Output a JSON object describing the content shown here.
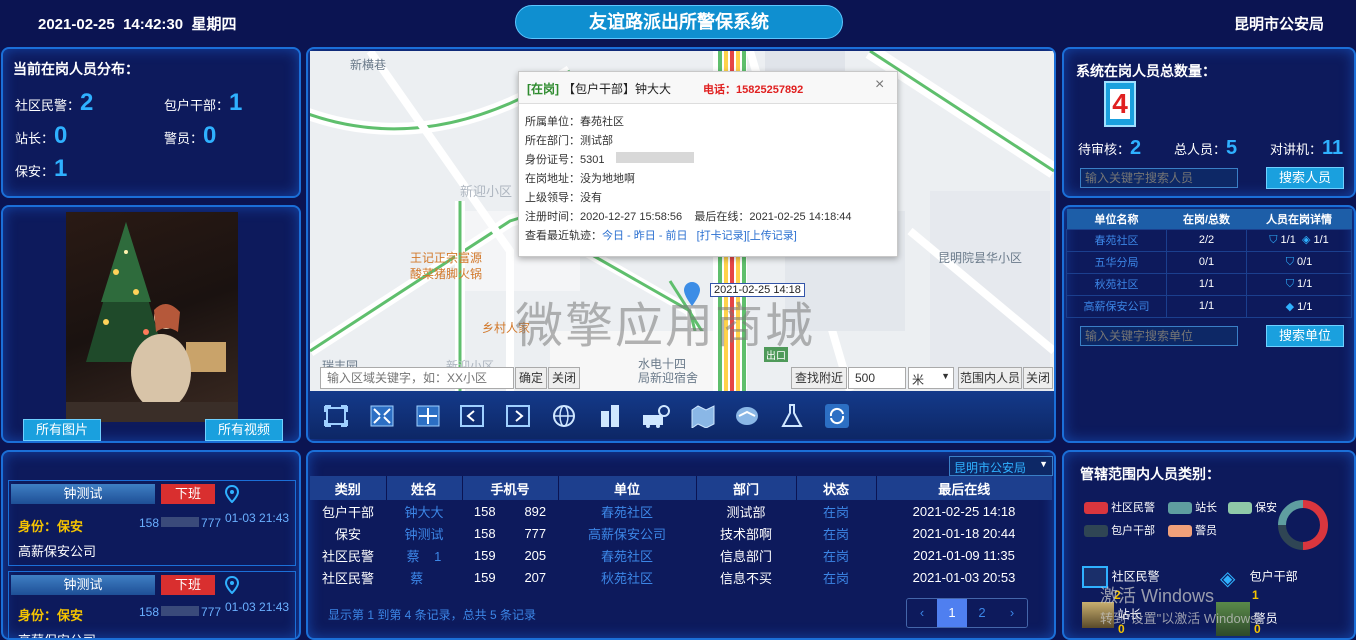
{
  "header": {
    "datetime": "2021-02-25  14:42:30  星期四",
    "title": "友谊路派出所警保系统",
    "org": "昆明市公安局"
  },
  "distribution": {
    "title": "当前在岗人员分布：",
    "items": [
      {
        "label": "社区民警：",
        "value": "2"
      },
      {
        "label": "包户干部：",
        "value": "1"
      },
      {
        "label": "站长：",
        "value": "0"
      },
      {
        "label": "警员：",
        "value": "0"
      },
      {
        "label": "保安：",
        "value": "1"
      }
    ]
  },
  "media": {
    "all_photos": "所有图片",
    "all_videos": "所有视频"
  },
  "persons": [
    {
      "name": "钟测试",
      "action": "下班",
      "identity": "身份：保安",
      "phone": "158",
      "phone_tail": "777",
      "time": "01-03 21:43",
      "unit": "高薪保安公司"
    },
    {
      "name": "钟测试",
      "action": "下班",
      "identity": "身份：保安",
      "phone": "158",
      "phone_tail": "777",
      "time": "01-03 21:43",
      "unit": "高薪保安公司"
    }
  ],
  "map": {
    "labels": [
      "新横巷",
      "新迎小区",
      "王记正宗富源",
      "酸菜猪脚火锅",
      "乡村人家",
      "昆明院昙华小区",
      "水电十四",
      "局新迎宿舍",
      "瑞丰园",
      "新迎小区",
      "出口"
    ],
    "watermark": "微擎应用商城",
    "marker_time": "2021-02-25 14:18",
    "popup": {
      "status": "[在岗]",
      "role_name": "【包户干部】钟大大",
      "phone": "电话：15825257892",
      "lines": [
        "所属单位：春苑社区",
        "所在部门：测试部",
        "身份证号：5301            42341",
        "在岗地址：没为地地啊",
        "上级领导：没有",
        "注册时间：2020-12-27 15:58:56    最后在线：2021-02-25 14:18:44"
      ],
      "track_label": "查看最近轨迹：",
      "track_links": "今日 - 昨日 - 前日",
      "punch_link": "[打卡记录]",
      "upload_link": "[上传记录]",
      "close": "×"
    },
    "search_placeholder": "输入区域关键字，如：XX小区",
    "confirm": "确定",
    "close1": "关闭",
    "find_nearby": "查找附近",
    "radius": "500",
    "unit": "米",
    "in_range": "范围内人员",
    "close2": "关闭"
  },
  "toolbar_icons": [
    "fullscreen-icon",
    "expand-icon",
    "collapse-icon",
    "prev-icon",
    "next-icon",
    "globe-icon",
    "building-icon",
    "search-vehicle-icon",
    "map-icon",
    "handshake-icon",
    "flask-icon",
    "refresh-icon"
  ],
  "table": {
    "dropdown": "昆明市公安局",
    "headers": [
      "类别",
      "姓名",
      "手机号",
      "单位",
      "部门",
      "状态",
      "最后在线"
    ],
    "rows": [
      [
        "包户干部",
        "钟大大",
        "158        892",
        "春苑社区",
        "测试部",
        "在岗",
        "2021-02-25 14:18"
      ],
      [
        "保安",
        "钟测试",
        "158        777",
        "高薪保安公司",
        "技术部啊",
        "在岗",
        "2021-01-18 20:44"
      ],
      [
        "社区民警",
        "蔡    1",
        "159        205",
        "春苑社区",
        "信息部门",
        "在岗",
        "2021-01-09 11:35"
      ],
      [
        "社区民警",
        "蔡    ",
        "159        207",
        "秋苑社区",
        "信息不买",
        "在岗",
        "2021-01-03 20:53"
      ]
    ],
    "footer": "显示第 1 到第 4 条记录，总共 5 条记录",
    "pages": [
      "‹",
      "1",
      "2",
      "›"
    ]
  },
  "total": {
    "title": "系统在岗人员总数量：",
    "count": "4",
    "pending_label": "待审核：",
    "pending": "2",
    "total_label": "总人员：",
    "total": "5",
    "talk_label": "对讲机：",
    "talk": "11",
    "search_placeholder": "输入关键字搜索人员",
    "search_btn": "搜索人员"
  },
  "units": {
    "headers": [
      "单位名称",
      "在岗/总数",
      "人员在岗详情"
    ],
    "rows": [
      {
        "name": "春苑社区",
        "ratio": "2/2",
        "d1": "1/1",
        "d2": "1/1"
      },
      {
        "name": "五华分局",
        "ratio": "0/1",
        "d1": "",
        "d2": "0/1"
      },
      {
        "name": "秋苑社区",
        "ratio": "1/1",
        "d1": "",
        "d2": "1/1"
      },
      {
        "name": "高薪保安公司",
        "ratio": "1/1",
        "d1": "",
        "d2": "1/1"
      }
    ],
    "search_placeholder": "输入关键字搜索单位",
    "search_btn": "搜索单位"
  },
  "categories": {
    "title": "管辖范围内人员类别：",
    "legend": [
      {
        "label": "社区民警",
        "color": "#d9363e"
      },
      {
        "label": "站长",
        "color": "#5f9ea0"
      },
      {
        "label": "保安",
        "color": "#8fc9a8"
      },
      {
        "label": "包户干部",
        "color": "#2f4554"
      },
      {
        "label": "警员",
        "color": "#f0a07a"
      }
    ],
    "donut": [
      {
        "label": "社区民警",
        "value": 2,
        "color": "#d9363e"
      },
      {
        "label": "包户干部",
        "value": 1,
        "color": "#2f4554"
      },
      {
        "label": "保安",
        "value": 1,
        "color": "#5f9ea0"
      }
    ],
    "tiles": [
      {
        "label": "社区民警",
        "value": "2"
      },
      {
        "label": "包户干部",
        "value": "1"
      },
      {
        "label": "站长",
        "value": "0"
      },
      {
        "label": "警员",
        "value": "0"
      }
    ]
  },
  "activation": {
    "line1": "激活 Windows",
    "line2": "转到\"设置\"以激活 Windows。"
  }
}
